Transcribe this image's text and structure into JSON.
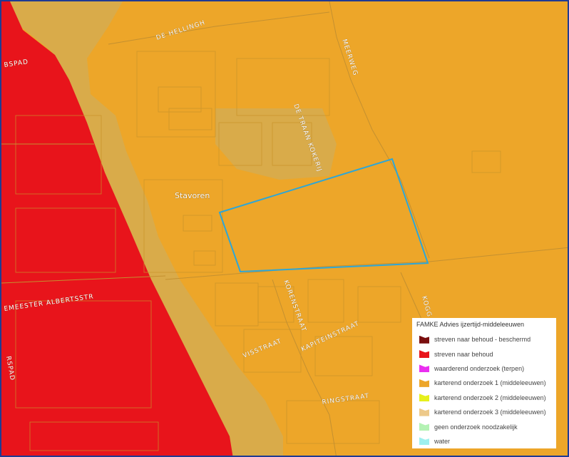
{
  "map": {
    "place_label": "Stavoren",
    "streets": {
      "de_hellingh": "DE HELLINGH",
      "bspad": "BSPAD",
      "meerweg": "MEERWEG",
      "de_traan_kokerij": "DE TRAAN KOKERIJ",
      "burgemeester_albertsstr": "EMEESTER ALBERTSSTR",
      "korenstraat": "KORENSTRAAT",
      "kogge": "KOGG",
      "visstraat": "VISSTRAAT",
      "kapiteinstraat": "KAPITEINSTRAAT",
      "ringstraat": "RINGSTRAAT",
      "left_edge": "RSPAD"
    },
    "colors": {
      "red_zone": "#e8141b",
      "orange_zone": "#eda629",
      "tan_zone": "#d9ab4a",
      "study_outline": "#2ea6d6",
      "frame": "#1f3a93"
    }
  },
  "legend": {
    "title": "FAMKE Advies ijzertijd-middeleeuwen",
    "items": [
      {
        "label": "streven naar behoud - beschermd",
        "color": "#7a0f0f"
      },
      {
        "label": "streven naar behoud",
        "color": "#e8141b"
      },
      {
        "label": "waarderend onderzoek (terpen)",
        "color": "#ea2ff0"
      },
      {
        "label": "karterend onderzoek 1 (middeleeuwen)",
        "color": "#eda629"
      },
      {
        "label": "karterend onderzoek 2 (middeleeuwen)",
        "color": "#e6f01c"
      },
      {
        "label": "karterend onderzoek 3 (middeleeuwen)",
        "color": "#edc98a"
      },
      {
        "label": "geen onderzoek noodzakelijk",
        "color": "#b4f2b4"
      },
      {
        "label": "water",
        "color": "#9ef0ee"
      }
    ]
  }
}
